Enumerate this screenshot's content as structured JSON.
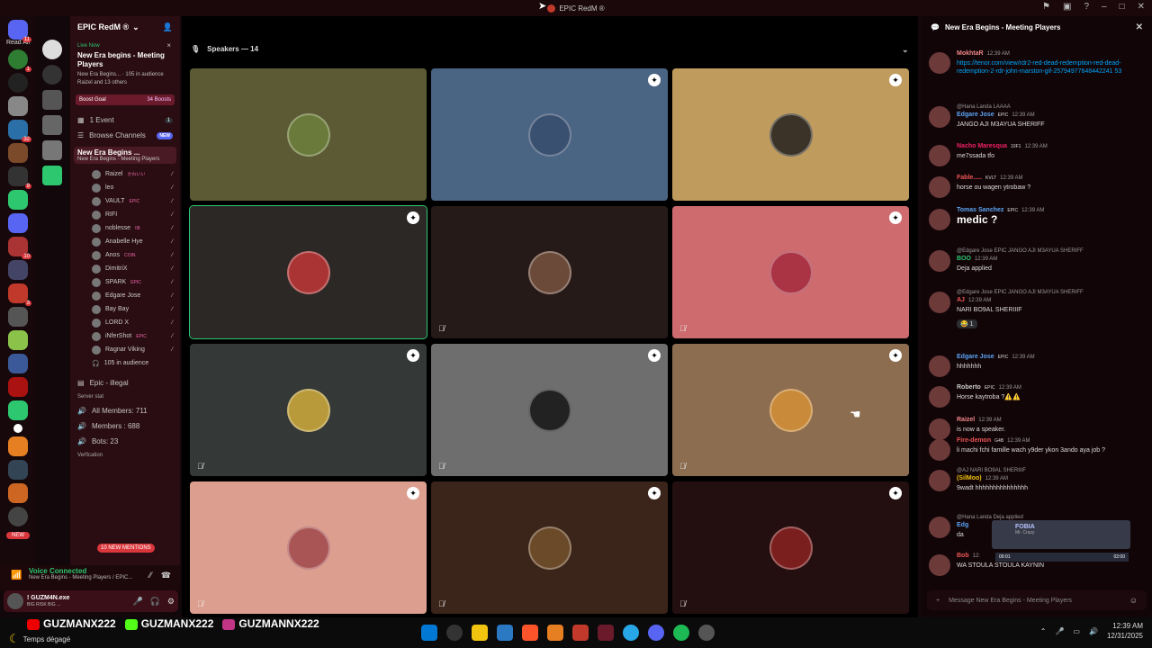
{
  "window": {
    "title": "EPIC RedM ®"
  },
  "rail": {
    "read_all": "Read All",
    "badges": [
      "11",
      "1",
      "3",
      "32",
      "1",
      "9",
      "1",
      "10",
      "3",
      "1",
      "2"
    ],
    "new_label": "NEW"
  },
  "server": {
    "name": "EPIC RedM ®"
  },
  "live": {
    "status": "Live Now",
    "title": "New Era begins - Meeting Players",
    "audience": "New Era Begins... · 105 in audience",
    "members": "Raizel and 13 others"
  },
  "boost": {
    "label": "Boost Goal",
    "value": "34 Boosts"
  },
  "nav": {
    "events": "1 Event",
    "events_count": "1",
    "browse": "Browse Channels",
    "browse_badge": "NEW"
  },
  "voice_channel": {
    "name": "New Era Begins ...",
    "topic": "New Era Begins - Meeting Players",
    "members": [
      {
        "name": "Raizel",
        "tag": "かわいい"
      },
      {
        "name": "leo",
        "tag": ""
      },
      {
        "name": "VAULT",
        "tag": "EPIC"
      },
      {
        "name": "RIFI",
        "tag": ""
      },
      {
        "name": "noblesse",
        "tag": "08"
      },
      {
        "name": "Anabelle Hye",
        "tag": ""
      },
      {
        "name": "Anos",
        "tag": "COIN"
      },
      {
        "name": "DimitriX",
        "tag": ""
      },
      {
        "name": "SPARK",
        "tag": "EPIC"
      },
      {
        "name": "Edgare Jose",
        "tag": ""
      },
      {
        "name": "Bay Bay",
        "tag": ""
      },
      {
        "name": "LORD X",
        "tag": ""
      },
      {
        "name": "iNferShot",
        "tag": "EPIC"
      },
      {
        "name": "Ragnar Viking",
        "tag": ""
      }
    ],
    "audience": "105 in audience"
  },
  "channels": {
    "epic_illegal": "Epic - illegal",
    "server_stat": "Server stat",
    "all_members": "All Members: 711",
    "members": "Members : 688",
    "bots": "Bots: 23",
    "verification": "Verfication",
    "mentions": "10 NEW MENTIONS"
  },
  "voice_status": {
    "connected": "Voice Connected",
    "location": "New Era Begins - Meeting Players / EPIC..."
  },
  "user": {
    "name": "! GUZM4N.exe",
    "status": "BIG RISK BIG ..."
  },
  "stage": {
    "header": "Speakers — 14",
    "tiles": [
      {
        "color": "#5b5a34",
        "badge": false,
        "muted": false,
        "active": false,
        "avatar": "#6a7a3a"
      },
      {
        "color": "#4a6483",
        "badge": true,
        "muted": false,
        "active": false,
        "avatar": "#3a5070"
      },
      {
        "color": "#bf9c5d",
        "badge": true,
        "muted": false,
        "active": false,
        "avatar": "#3b3327"
      },
      {
        "color": "#2c2826",
        "badge": true,
        "muted": false,
        "active": true,
        "avatar": "#a33"
      },
      {
        "color": "#261a18",
        "badge": false,
        "muted": true,
        "active": false,
        "avatar": "#6b4a3a"
      },
      {
        "color": "#cd6b6f",
        "badge": true,
        "muted": true,
        "active": false,
        "avatar": "#a34"
      },
      {
        "color": "#343837",
        "badge": true,
        "muted": true,
        "active": false,
        "avatar": "#b89a3a"
      },
      {
        "color": "#6e6e6e",
        "badge": true,
        "muted": true,
        "active": false,
        "avatar": "#222"
      },
      {
        "color": "#8c6d4f",
        "badge": true,
        "muted": true,
        "active": false,
        "avatar": "#c98a3a"
      },
      {
        "color": "#dc9e8e",
        "badge": true,
        "muted": true,
        "active": false,
        "avatar": "#a55"
      },
      {
        "color": "#3b2419",
        "badge": true,
        "muted": true,
        "active": false,
        "avatar": "#6b4a2a"
      },
      {
        "color": "#240f10",
        "badge": true,
        "muted": true,
        "active": false,
        "avatar": "#7a1e1e"
      }
    ]
  },
  "chat": {
    "title": "New Era Begins - Meeting Players",
    "messages": [
      {
        "reply": "",
        "name": "MokhtaR",
        "color": "#e88",
        "tag": "",
        "time": "12:39 AM",
        "text": "https://tenor.com/view/rdr2-red-dead-redemption-red-dead-redemption-2-rdr-john-marston-gif-25794977648442241 53",
        "link": true,
        "big": false,
        "reaction": ""
      },
      {
        "reply": "@Hana Landa LAAAA",
        "name": "Edgare Jose",
        "color": "#5aa5f5",
        "tag": "EPIC",
        "time": "12:39 AM",
        "text": "JANGO AJI M3AYUA SHERIFF",
        "link": false,
        "big": false,
        "reaction": ""
      },
      {
        "reply": "",
        "name": "Nacho Maresqua",
        "color": "#e26",
        "tag": "10F1",
        "time": "12:39 AM",
        "text": "me7ssada tfo",
        "link": false,
        "big": false,
        "reaction": ""
      },
      {
        "reply": "",
        "name": "Fable.....",
        "color": "#e55",
        "tag": "KVLT",
        "time": "12:39 AM",
        "text": "horse ou wagen ytrobaw ?",
        "link": false,
        "big": false,
        "reaction": ""
      },
      {
        "reply": "",
        "name": "Tomas Sanchez",
        "color": "#5aa5f5",
        "tag": "EPIC",
        "time": "12:39 AM",
        "text": "medic ?",
        "link": false,
        "big": true,
        "reaction": ""
      },
      {
        "reply": "@Edgare Jose EPIC JANGO AJI M3AYUA SHERIFF",
        "name": "BOO",
        "color": "#2dc770",
        "tag": "",
        "time": "12:39 AM",
        "text": "Deja applied",
        "link": false,
        "big": false,
        "reaction": ""
      },
      {
        "reply": "@Edgare Jose EPIC JANGO AJI M3AYUA SHERIFF",
        "name": "AJ",
        "color": "#e55",
        "tag": "",
        "time": "12:39 AM",
        "text": "NARI BO9AL SHERIIIF",
        "link": false,
        "big": false,
        "reaction": "😂 1"
      },
      {
        "reply": "",
        "name": "Edgare Jose",
        "color": "#5aa5f5",
        "tag": "EPIC",
        "time": "12:39 AM",
        "text": "hhhhhhh",
        "link": false,
        "big": false,
        "reaction": ""
      },
      {
        "reply": "",
        "name": "Roberto",
        "color": "#ccc",
        "tag": "EPIC",
        "time": "12:39 AM",
        "text": "Horse kaytroba ?⚠️⚠️",
        "link": false,
        "big": false,
        "reaction": ""
      },
      {
        "reply": "",
        "name": "Raizel",
        "color": "#e88",
        "tag": "",
        "time": "12:39 AM",
        "text": "is now a speaker.",
        "link": false,
        "big": false,
        "reaction": ""
      },
      {
        "reply": "",
        "name": "Fire-demon",
        "color": "#e55",
        "tag": "G4B",
        "time": "12:39 AM",
        "text": "li machi fchi famille wach y9der ykon 3ando aya job ?",
        "link": false,
        "big": false,
        "reaction": ""
      },
      {
        "reply": "@AJ NARI BO9AL SHERIIIF",
        "name": "(SilMoo)",
        "color": "#f1c40f",
        "tag": "",
        "time": "12:39 AM",
        "text": "9wadt hhhhhhhhhhhhhhh",
        "link": false,
        "big": false,
        "reaction": ""
      },
      {
        "reply": "@Hana Landa Deja applied",
        "name": "Edg",
        "color": "#5aa5f5",
        "tag": "",
        "time": "",
        "text": "da",
        "link": false,
        "big": false,
        "reaction": ""
      },
      {
        "reply": "",
        "name": "Bob",
        "color": "#e55",
        "tag": "",
        "time": "12:",
        "text": "WA STOULA STOULA KAYNIN",
        "link": false,
        "big": false,
        "reaction": ""
      }
    ],
    "input_placeholder": "Message New Era Begins - Meeting Players",
    "music": {
      "title": "FOBIA",
      "subtitle": "Mr. Crazy",
      "start": "00:01",
      "end": "02:00"
    }
  },
  "overlay": {
    "handles": [
      "GUZMANX222",
      "GUZMANX222",
      "GUZMANNX222"
    ],
    "weather": "Temps dégagé"
  },
  "tray": {
    "time": "12:39 AM",
    "date": "12/31/2025"
  }
}
